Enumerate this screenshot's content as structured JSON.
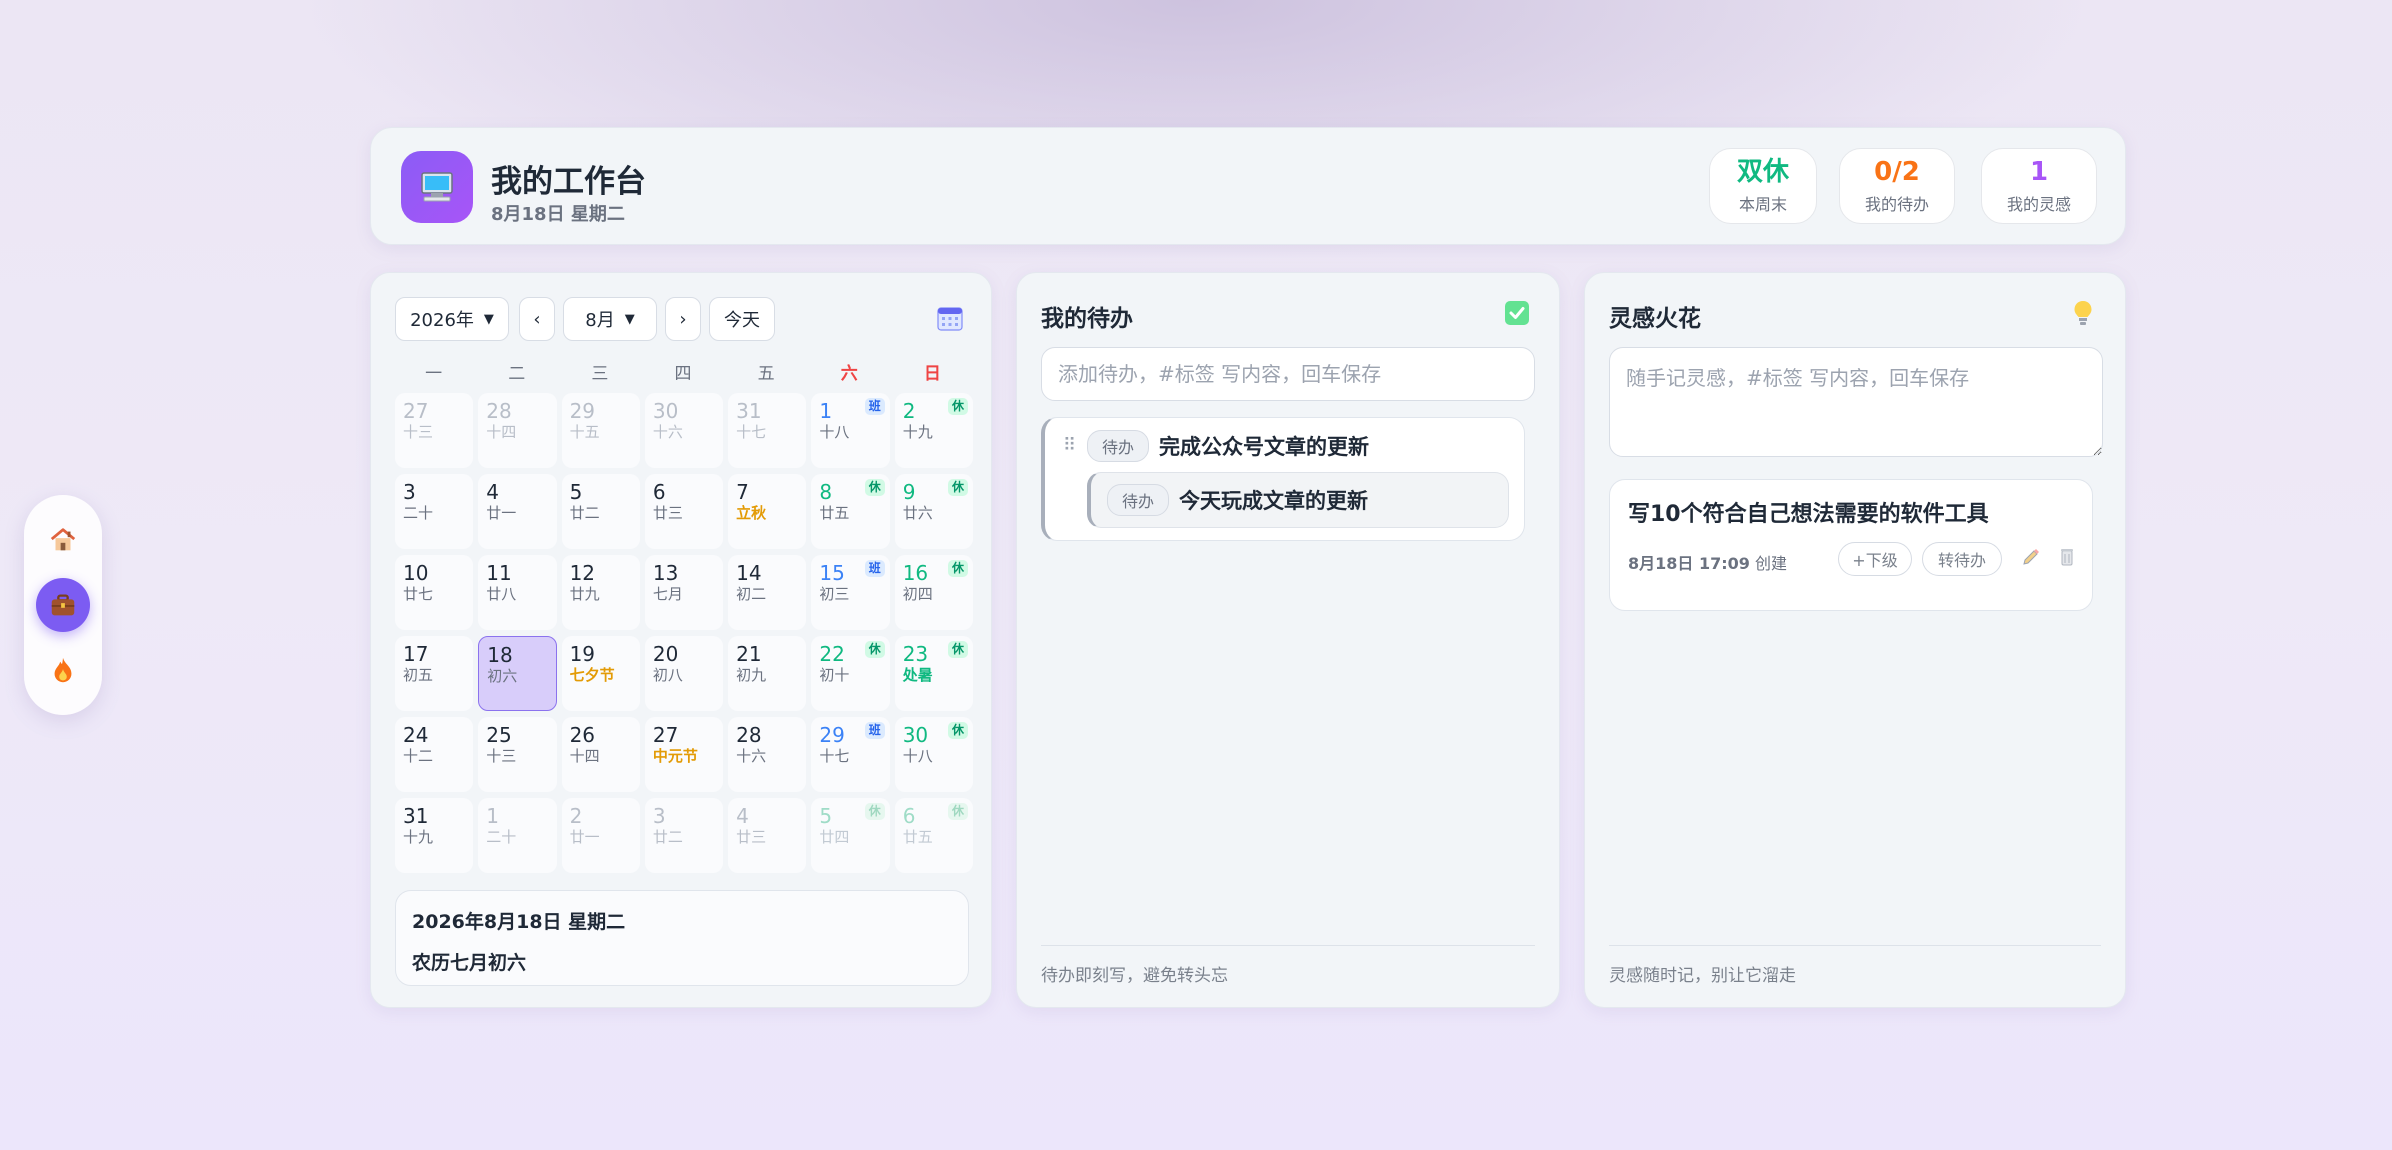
{
  "dock": {
    "items": [
      "home-icon",
      "briefcase-icon",
      "fire-icon"
    ],
    "active_index": 1
  },
  "header": {
    "title": "我的工作台",
    "date": "8月18日 星期二",
    "stats": [
      {
        "value": "双休",
        "label": "本周末",
        "color": "#10b981"
      },
      {
        "value": "0/2",
        "label": "我的待办",
        "color": "#f97316"
      },
      {
        "value": "1",
        "label": "我的灵感",
        "color": "#a855f7"
      }
    ]
  },
  "calendar": {
    "year_select": "2026年",
    "month_select": "8月",
    "prev_label": "‹",
    "next_label": "›",
    "today_button": "今天",
    "weekdays": [
      "一",
      "二",
      "三",
      "四",
      "五",
      "六",
      "日"
    ],
    "weeks": [
      [
        {
          "d": "27",
          "l": "十三",
          "other": true
        },
        {
          "d": "28",
          "l": "十四",
          "other": true
        },
        {
          "d": "29",
          "l": "十五",
          "other": true
        },
        {
          "d": "30",
          "l": "十六",
          "other": true
        },
        {
          "d": "31",
          "l": "十七",
          "other": true
        },
        {
          "d": "1",
          "l": "十八",
          "tone": "blue",
          "badge": "班"
        },
        {
          "d": "2",
          "l": "十九",
          "tone": "green",
          "badge": "休"
        }
      ],
      [
        {
          "d": "3",
          "l": "二十"
        },
        {
          "d": "4",
          "l": "廿一"
        },
        {
          "d": "5",
          "l": "廿二"
        },
        {
          "d": "6",
          "l": "廿三"
        },
        {
          "d": "7",
          "l": "立秋",
          "lt": "fest"
        },
        {
          "d": "8",
          "l": "廿五",
          "tone": "green",
          "badge": "休"
        },
        {
          "d": "9",
          "l": "廿六",
          "tone": "green",
          "badge": "休"
        }
      ],
      [
        {
          "d": "10",
          "l": "廿七"
        },
        {
          "d": "11",
          "l": "廿八"
        },
        {
          "d": "12",
          "l": "廿九"
        },
        {
          "d": "13",
          "l": "七月"
        },
        {
          "d": "14",
          "l": "初二"
        },
        {
          "d": "15",
          "l": "初三",
          "tone": "blue",
          "badge": "班"
        },
        {
          "d": "16",
          "l": "初四",
          "tone": "green",
          "badge": "休"
        }
      ],
      [
        {
          "d": "17",
          "l": "初五"
        },
        {
          "d": "18",
          "l": "初六",
          "today": true
        },
        {
          "d": "19",
          "l": "七夕节",
          "lt": "fest"
        },
        {
          "d": "20",
          "l": "初八"
        },
        {
          "d": "21",
          "l": "初九"
        },
        {
          "d": "22",
          "l": "初十",
          "tone": "green",
          "badge": "休"
        },
        {
          "d": "23",
          "l": "处暑",
          "lt": "term",
          "tone": "green",
          "badge": "休"
        }
      ],
      [
        {
          "d": "24",
          "l": "十二"
        },
        {
          "d": "25",
          "l": "十三"
        },
        {
          "d": "26",
          "l": "十四"
        },
        {
          "d": "27",
          "l": "中元节",
          "lt": "fest"
        },
        {
          "d": "28",
          "l": "十六"
        },
        {
          "d": "29",
          "l": "十七",
          "tone": "blue",
          "badge": "班"
        },
        {
          "d": "30",
          "l": "十八",
          "tone": "green",
          "badge": "休"
        }
      ],
      [
        {
          "d": "31",
          "l": "十九"
        },
        {
          "d": "1",
          "l": "二十",
          "other": true
        },
        {
          "d": "2",
          "l": "廿一",
          "other": true
        },
        {
          "d": "3",
          "l": "廿二",
          "other": true
        },
        {
          "d": "4",
          "l": "廿三",
          "other": true
        },
        {
          "d": "5",
          "l": "廿四",
          "other": true,
          "tone": "green",
          "badge": "休"
        },
        {
          "d": "6",
          "l": "廿五",
          "other": true,
          "tone": "green",
          "badge": "休"
        }
      ]
    ],
    "selected_date": "2026年8月18日 星期二",
    "selected_lunar": "农历七月初六"
  },
  "todo": {
    "title": "我的待办",
    "placeholder": "添加待办，#标签 写内容，回车保存",
    "items": [
      {
        "tag": "待办",
        "text": "完成公众号文章的更新"
      },
      {
        "tag": "待办",
        "text": "今天玩成文章的更新"
      }
    ],
    "footer": "待办即刻写，避免转头忘"
  },
  "ideas": {
    "title": "灵感火花",
    "placeholder": "随手记灵感，#标签 写内容，回车保存",
    "item": {
      "text": "写10个符合自己想法需要的软件工具",
      "time": "8月18日 17:09",
      "created": "创建",
      "sub_button": "+下级",
      "convert_button": "转待办"
    },
    "footer": "灵感随时记，别让它溜走"
  }
}
